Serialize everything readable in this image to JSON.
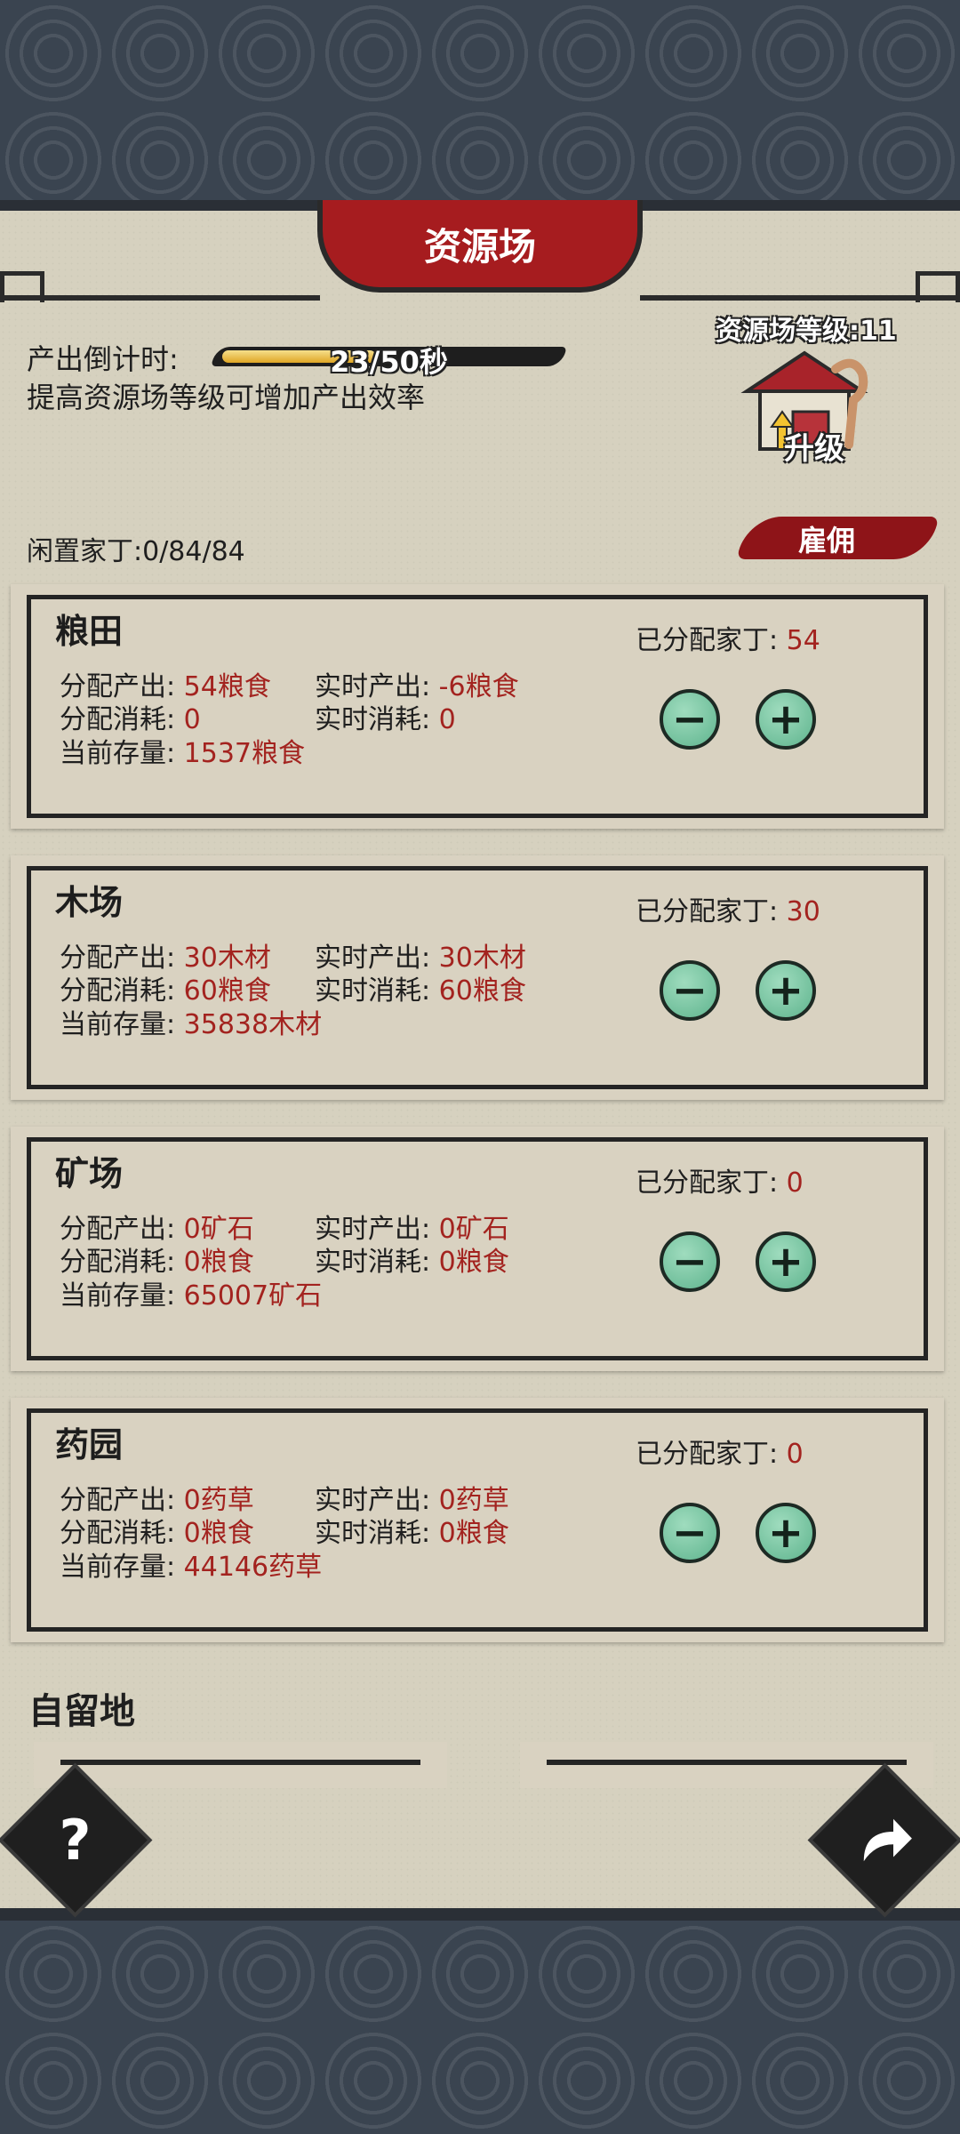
{
  "header": {
    "title": "资源场"
  },
  "production": {
    "countdown_label": "产出倒计时:",
    "countdown_value": "23/50秒",
    "countdown_progress": 0.46,
    "tip": "提高资源场等级可增加产出效率"
  },
  "level": {
    "label": "资源场等级:11",
    "upgrade_label": "升级"
  },
  "idle": {
    "label": "闲置家丁:0/84/84"
  },
  "hire": {
    "label": "雇佣"
  },
  "fields": [
    {
      "name": "粮田",
      "output_label": "分配产出:",
      "output": "54粮食",
      "realtime_output_label": "实时产出:",
      "realtime_output": "-6粮食",
      "cost_label": "分配消耗:",
      "cost": "0",
      "realtime_cost_label": "实时消耗:",
      "realtime_cost": "0",
      "stock_label": "当前存量:",
      "stock": "1537粮食",
      "assigned_label": "已分配家丁:",
      "assigned": "54"
    },
    {
      "name": "木场",
      "output_label": "分配产出:",
      "output": "30木材",
      "realtime_output_label": "实时产出:",
      "realtime_output": "30木材",
      "cost_label": "分配消耗:",
      "cost": "60粮食",
      "realtime_cost_label": "实时消耗:",
      "realtime_cost": "60粮食",
      "stock_label": "当前存量:",
      "stock": "35838木材",
      "assigned_label": "已分配家丁:",
      "assigned": "30"
    },
    {
      "name": "矿场",
      "output_label": "分配产出:",
      "output": "0矿石",
      "realtime_output_label": "实时产出:",
      "realtime_output": "0矿石",
      "cost_label": "分配消耗:",
      "cost": "0粮食",
      "realtime_cost_label": "实时消耗:",
      "realtime_cost": "0粮食",
      "stock_label": "当前存量:",
      "stock": "65007矿石",
      "assigned_label": "已分配家丁:",
      "assigned": "0"
    },
    {
      "name": "药园",
      "output_label": "分配产出:",
      "output": "0药草",
      "realtime_output_label": "实时产出:",
      "realtime_output": "0药草",
      "cost_label": "分配消耗:",
      "cost": "0粮食",
      "realtime_cost_label": "实时消耗:",
      "realtime_cost": "0粮食",
      "stock_label": "当前存量:",
      "stock": "44146药草",
      "assigned_label": "已分配家丁:",
      "assigned": "0"
    }
  ],
  "buttons": {
    "minus": "−",
    "plus": "+",
    "help": "?"
  },
  "section": {
    "title": "自留地"
  },
  "icons": [
    "minus-icon",
    "plus-icon",
    "question-icon",
    "share-arrow-icon",
    "house-icon",
    "upgrade-arrow-icon"
  ],
  "colors": {
    "title_red": "#a61c1f",
    "value_red": "#a3231f",
    "button_green": "#6dbf98",
    "panel": "#d6d1bf"
  }
}
